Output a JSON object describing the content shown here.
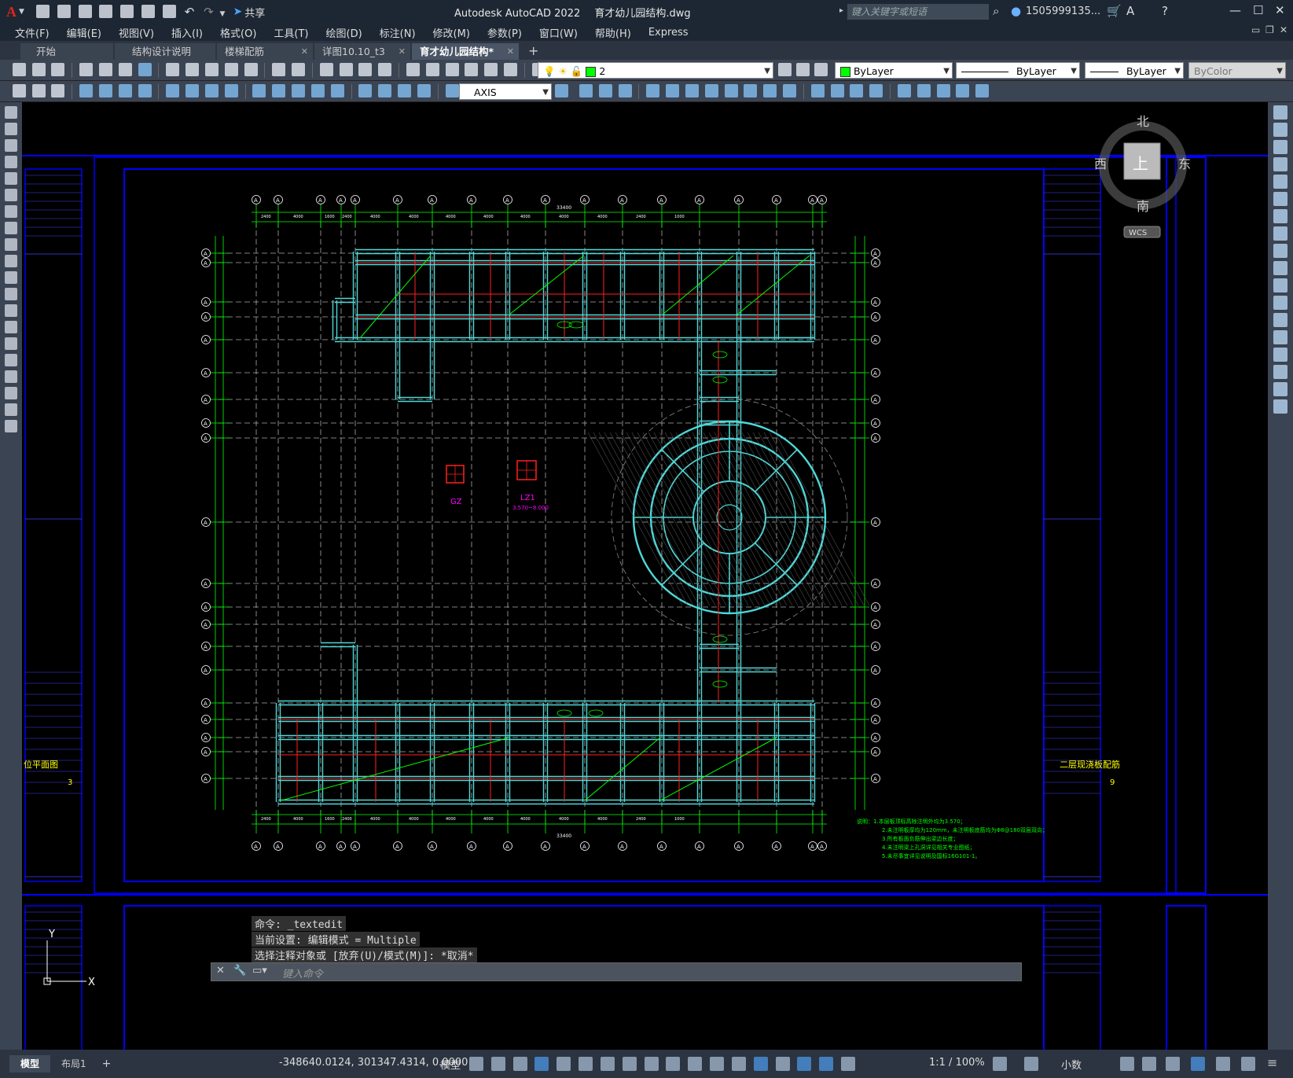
{
  "app": {
    "logo": "A",
    "title": "Autodesk AutoCAD 2022",
    "filename": "育才幼儿园结构.dwg",
    "share_label": "共享",
    "search_placeholder": "键入关键字或短语",
    "user": "1505999135...",
    "icons": [
      "new-icon",
      "open-icon",
      "save-icon",
      "saveas-icon",
      "plot-icon",
      "undo-icon",
      "redo-icon",
      "share-icon",
      "search-icon",
      "user-icon",
      "cart-icon",
      "help-icon",
      "minimize-icon",
      "maximize-icon",
      "close-icon"
    ]
  },
  "menu": [
    "文件(F)",
    "编辑(E)",
    "视图(V)",
    "插入(I)",
    "格式(O)",
    "工具(T)",
    "绘图(D)",
    "标注(N)",
    "修改(M)",
    "参数(P)",
    "窗口(W)",
    "帮助(H)",
    "Express"
  ],
  "tabs": [
    {
      "label": "开始",
      "closable": false,
      "active": false
    },
    {
      "label": "结构设计说明",
      "closable": false,
      "active": false
    },
    {
      "label": "楼梯配筋",
      "closable": true,
      "active": false
    },
    {
      "label": "详图10.10_t3",
      "closable": true,
      "active": false
    },
    {
      "label": "育才幼儿园结构*",
      "closable": true,
      "active": true
    }
  ],
  "toolbar": {
    "layer_value": "2",
    "color_value": "ByLayer",
    "linetype_value": "ByLayer",
    "lineweight_value": "ByLayer",
    "plotstyle_value": "ByColor",
    "textstyle_value": "AXIS"
  },
  "viewcube": {
    "north": "北",
    "south": "南",
    "east": "东",
    "west": "西",
    "top": "上",
    "wcs": "WCS"
  },
  "drawing": {
    "title_right": "二层现浇板配筋",
    "title_left": "位平面图",
    "sheet_no_right": "9",
    "sheet_no_left": "3",
    "col_marker_gz": "GZ",
    "col_marker_lz": "LZ1",
    "col_marker_lz_note": "3.570~8.000",
    "axis_tags": [
      "A",
      "A",
      "A",
      "A",
      "A",
      "A",
      "A",
      "A",
      "A",
      "A",
      "A",
      "A",
      "A",
      "A",
      "A",
      "A"
    ],
    "dims_top": [
      "2400",
      "4000",
      "1600",
      "2400",
      "4000",
      "4000",
      "4000",
      "4000",
      "4000",
      "4000",
      "4000",
      "2400",
      "1000"
    ],
    "dim_total": "33400",
    "notes": [
      "说明：1.本层板顶标高除注明外均为3.570；",
      "2.未注明板厚均为120mm，未注明板底筋均为Φ8@180双层双向；",
      "3.所有板面负筋伸出梁边长度；",
      "4.未注明梁上孔洞详见相关专业图纸；",
      "5.未尽事宜详见说明及国标16G101-1。"
    ]
  },
  "command": {
    "line1": "命令: _textedit",
    "line2": "当前设置: 编辑模式 = Multiple",
    "line3": "选择注释对象或 [放弃(U)/模式(M)]: *取消*",
    "input_placeholder": "键入命令"
  },
  "ucs": {
    "x": "X",
    "y": "Y"
  },
  "status": {
    "model_tab": "模型",
    "layout_tab": "布局1",
    "add_tab": "+",
    "coords": "-348640.0124, 301347.4314, 0.0000",
    "space": "模型",
    "scale": "1:1 / 100%",
    "units": "小数"
  },
  "colors": {
    "bg": "#000000",
    "frame": "#0000ff",
    "grid": "#00ff00",
    "beam": "#4fd8d8",
    "rebar": "#ff2020",
    "axis": "#c8c8c8"
  }
}
